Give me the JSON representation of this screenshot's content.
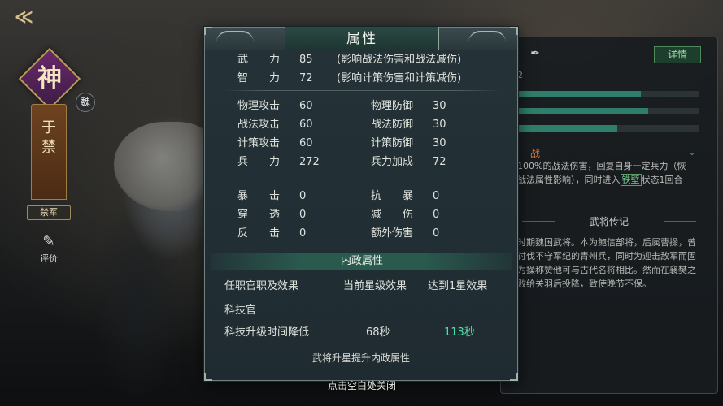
{
  "hero": {
    "rank_glyph": "神",
    "faction": "魏",
    "name_chars": [
      "于",
      "禁"
    ],
    "troop_label": "禁军",
    "review_label": "评价"
  },
  "back": {
    "icon": "back-arrow-icon",
    "glyph": "≪"
  },
  "right_panel": {
    "detail_label": "详情",
    "partial_number": "2",
    "bars": [
      0.68,
      0.72,
      0.55
    ],
    "skill_icon_text": "战",
    "skill_desc_lines": [
      "100%的战法伤害，回复自身一定兵力（恢",
      "战法属性影响），同时进入",
      "铁壁",
      "状态1回合"
    ],
    "bio_title": "武将传记",
    "bio_lines": [
      "时期魏国武将。本为鲍信部将，后属曹操，曾",
      "讨伐不守军纪的青州兵，同时为迎击敌军而固",
      "为操称赞他可与古代名将相比。然而在襄樊之",
      "败给关羽后投降，致使晚节不保。"
    ]
  },
  "modal": {
    "title": "属性",
    "core_stats": [
      {
        "label": "武　　力",
        "value": "85",
        "note": "(影响战法伤害和战法减伤)"
      },
      {
        "label": "智　　力",
        "value": "72",
        "note": "(影响计策伤害和计策减伤)"
      }
    ],
    "combat_left": [
      {
        "label": "物理攻击",
        "value": "60"
      },
      {
        "label": "战法攻击",
        "value": "60"
      },
      {
        "label": "计策攻击",
        "value": "60"
      },
      {
        "label": "兵　　力",
        "value": "272"
      }
    ],
    "combat_right": [
      {
        "label": "物理防御",
        "value": "30"
      },
      {
        "label": "战法防御",
        "value": "30"
      },
      {
        "label": "计策防御",
        "value": "30"
      },
      {
        "label": "兵力加成",
        "value": "72"
      }
    ],
    "special_left": [
      {
        "label": "暴　　击",
        "value": "0"
      },
      {
        "label": "穿　　透",
        "value": "0"
      },
      {
        "label": "反　　击",
        "value": "0"
      }
    ],
    "special_right": [
      {
        "label": "抗　　暴",
        "value": "0"
      },
      {
        "label": "减　　伤",
        "value": "0"
      },
      {
        "label": "额外伤害",
        "value": "0"
      }
    ],
    "civil_title": "内政属性",
    "civil_headers": {
      "col1": "任职官职及效果",
      "col2": "当前星级效果",
      "col3": "达到1星效果"
    },
    "civil_post": "科技官",
    "civil_row": {
      "name": "科技升级时间降低",
      "current": "68秒",
      "next": "113秒"
    },
    "upgrade_hint": "武将升星提升内政属性"
  },
  "close_hint": "点击空白处关闭",
  "colors": {
    "accent_green": "#49e0a4",
    "panel_bg": "#223036",
    "section_bar": "#2a5a4e"
  }
}
